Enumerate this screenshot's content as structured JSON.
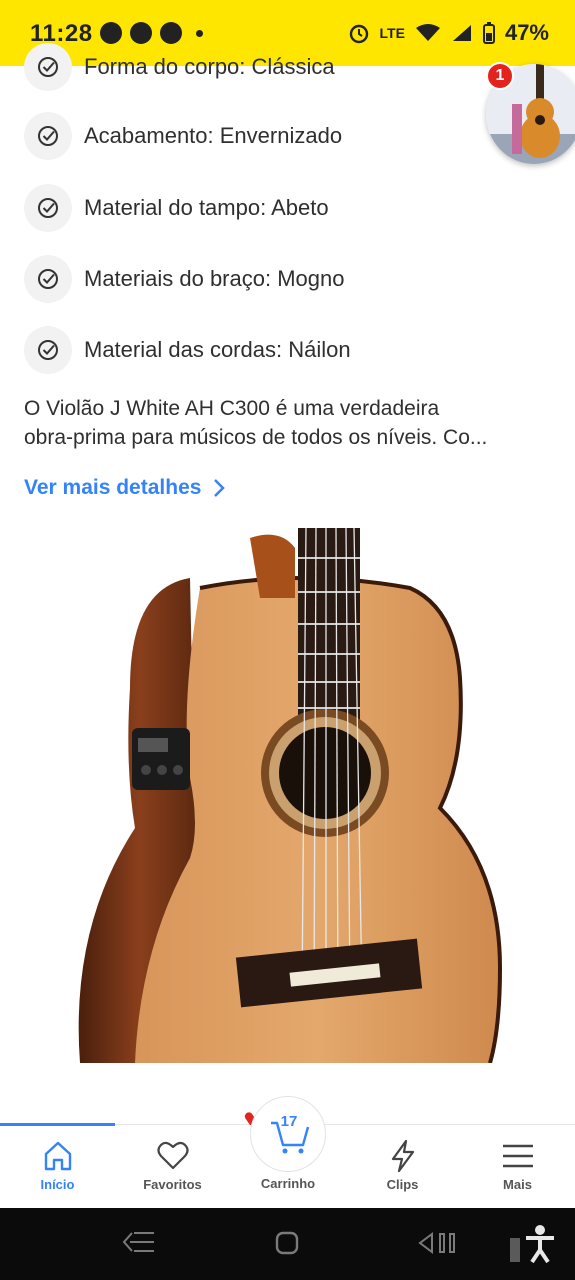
{
  "status_bar": {
    "time": "11:28",
    "network": "LTE",
    "battery": "47%",
    "notification_badge": "1"
  },
  "specs": [
    {
      "label": "Forma do corpo: Clássica"
    },
    {
      "label": "Acabamento: Envernizado"
    },
    {
      "label": "Material do tampo: Abeto"
    },
    {
      "label": "Materiais do braço: Mogno"
    },
    {
      "label": "Material das cordas: Náilon"
    }
  ],
  "description": {
    "line1": "O Violão J White AH C300 é uma verdadeira",
    "line2": "obra-prima para músicos de todos os níveis. Co..."
  },
  "more_link": "Ver mais detalhes",
  "bottom_nav": {
    "inicio": "Início",
    "favoritos": "Favoritos",
    "carrinho": "Carrinho",
    "cart_count": "17",
    "clips": "Clips",
    "mais": "Mais"
  },
  "colors": {
    "status_bar": "#ffe600",
    "accent": "#3483fa",
    "badge": "#e3231e"
  }
}
